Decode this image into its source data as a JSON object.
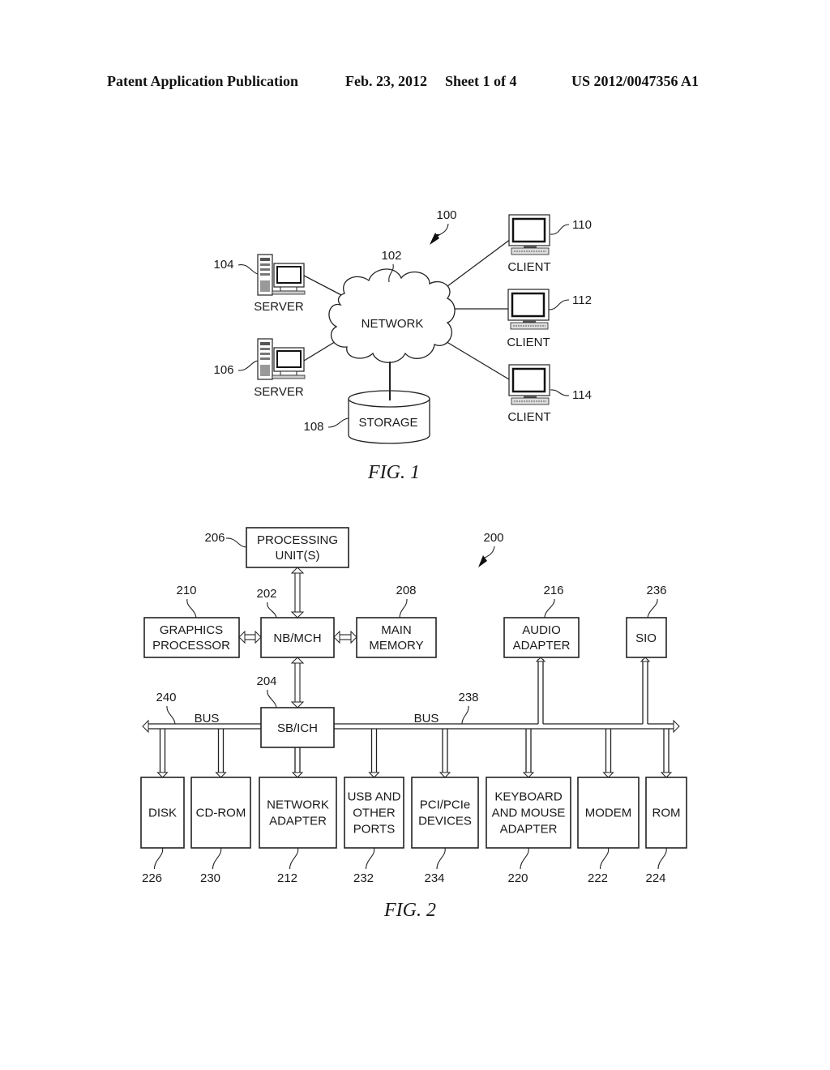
{
  "header": {
    "publication": "Patent Application Publication",
    "date": "Feb. 23, 2012",
    "sheet": "Sheet 1 of 4",
    "number": "US 2012/0047356 A1"
  },
  "fig1": {
    "caption": "FIG. 1",
    "system_ref": "100",
    "network": {
      "label": "NETWORK",
      "ref": "102"
    },
    "servers": [
      {
        "label": "SERVER",
        "ref": "104"
      },
      {
        "label": "SERVER",
        "ref": "106"
      }
    ],
    "storage": {
      "label": "STORAGE",
      "ref": "108"
    },
    "clients": [
      {
        "label": "CLIENT",
        "ref": "110"
      },
      {
        "label": "CLIENT",
        "ref": "112"
      },
      {
        "label": "CLIENT",
        "ref": "114"
      }
    ]
  },
  "fig2": {
    "caption": "FIG. 2",
    "system_ref": "200",
    "processing_unit": {
      "line1": "PROCESSING",
      "line2": "UNIT(S)",
      "ref": "206"
    },
    "nb_mch": {
      "label": "NB/MCH",
      "ref": "202"
    },
    "graphics": {
      "line1": "GRAPHICS",
      "line2": "PROCESSOR",
      "ref": "210"
    },
    "main_memory": {
      "line1": "MAIN",
      "line2": "MEMORY",
      "ref": "208"
    },
    "audio": {
      "line1": "AUDIO",
      "line2": "ADAPTER",
      "ref": "216"
    },
    "sio": {
      "label": "SIO",
      "ref": "236"
    },
    "sb_ich": {
      "label": "SB/ICH",
      "ref": "204"
    },
    "bus_left": {
      "label": "BUS",
      "ref": "240"
    },
    "bus_right": {
      "label": "BUS",
      "ref": "238"
    },
    "devices": [
      {
        "lines": [
          "DISK"
        ],
        "ref": "226"
      },
      {
        "lines": [
          "CD-ROM"
        ],
        "ref": "230"
      },
      {
        "lines": [
          "NETWORK",
          "ADAPTER"
        ],
        "ref": "212"
      },
      {
        "lines": [
          "USB AND",
          "OTHER",
          "PORTS"
        ],
        "ref": "232"
      },
      {
        "lines": [
          "PCI/PCIe",
          "DEVICES"
        ],
        "ref": "234"
      },
      {
        "lines": [
          "KEYBOARD",
          "AND MOUSE",
          "ADAPTER"
        ],
        "ref": "220"
      },
      {
        "lines": [
          "MODEM"
        ],
        "ref": "222"
      },
      {
        "lines": [
          "ROM"
        ],
        "ref": "224"
      }
    ]
  }
}
